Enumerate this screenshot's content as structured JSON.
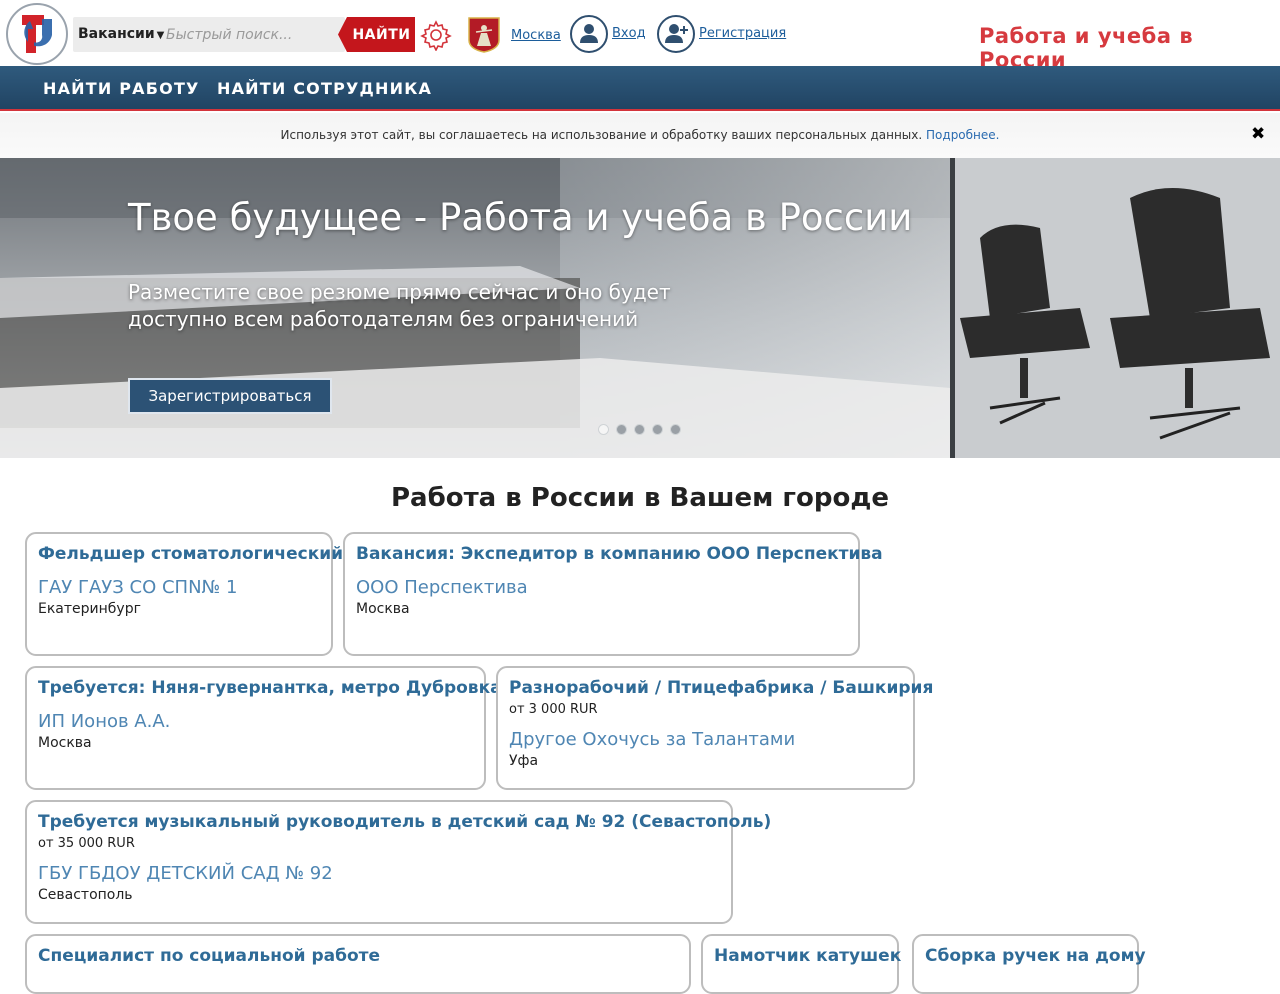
{
  "header": {
    "search_type": "Вакансии",
    "search_placeholder": "Быстрый поиск...",
    "search_button": "НАЙТИ",
    "region": "Москва",
    "login": "Вход",
    "register": "Регистрация",
    "site_title": "Работа и учеба в России"
  },
  "nav": {
    "items": [
      "НАЙТИ РАБОТУ",
      "НАЙТИ СОТРУДНИКА"
    ]
  },
  "cookie": {
    "text": "Используя этот сайт, вы соглашаетесь на использование и обработку ваших персональных данных.",
    "more": "Подробнее.",
    "close": "✖"
  },
  "hero": {
    "title": "Твое будущее - Работа и учеба в России",
    "subtitle": "Разместите свое резюме прямо сейчас и оно будет доступно всем работодателям без ограничений",
    "button": "Зарегистрироваться",
    "slides": 5,
    "active_slide": 1
  },
  "section": {
    "title": "Работа в России в Вашем городе"
  },
  "jobs": [
    {
      "title": "Фельдшер стоматологический",
      "salary": "",
      "company": "ГАУ ГАУЗ СО СПN№ 1",
      "city": "Екатеринбург"
    },
    {
      "title": "Вакансия: Экспедитор в компанию ООО Перспектива",
      "salary": "",
      "company": "ООО Перспектива",
      "city": "Москва"
    },
    {
      "title": "Требуется: Няня-гувернантка, метро Дубровка.",
      "salary": "",
      "company": "ИП Ионов А.А.",
      "city": "Москва"
    },
    {
      "title": "Разнорабочий / Птицефабрика / Башкирия",
      "salary": "от 3 000 RUR",
      "company": "Другое Охочусь за Талантами",
      "city": "Уфа"
    },
    {
      "title": "Требуется музыкальный руководитель в детский сад № 92 (Севастополь)",
      "salary": "от 35 000 RUR",
      "company": "ГБУ ГБДОУ ДЕТСКИЙ САД № 92",
      "city": "Севастополь"
    },
    {
      "title": "Специалист по социальной работе",
      "salary": "",
      "company": "",
      "city": ""
    },
    {
      "title": "Намотчик катушек",
      "salary": "",
      "company": "",
      "city": ""
    },
    {
      "title": "Сборка ручек на дому",
      "salary": "",
      "company": "",
      "city": ""
    }
  ]
}
